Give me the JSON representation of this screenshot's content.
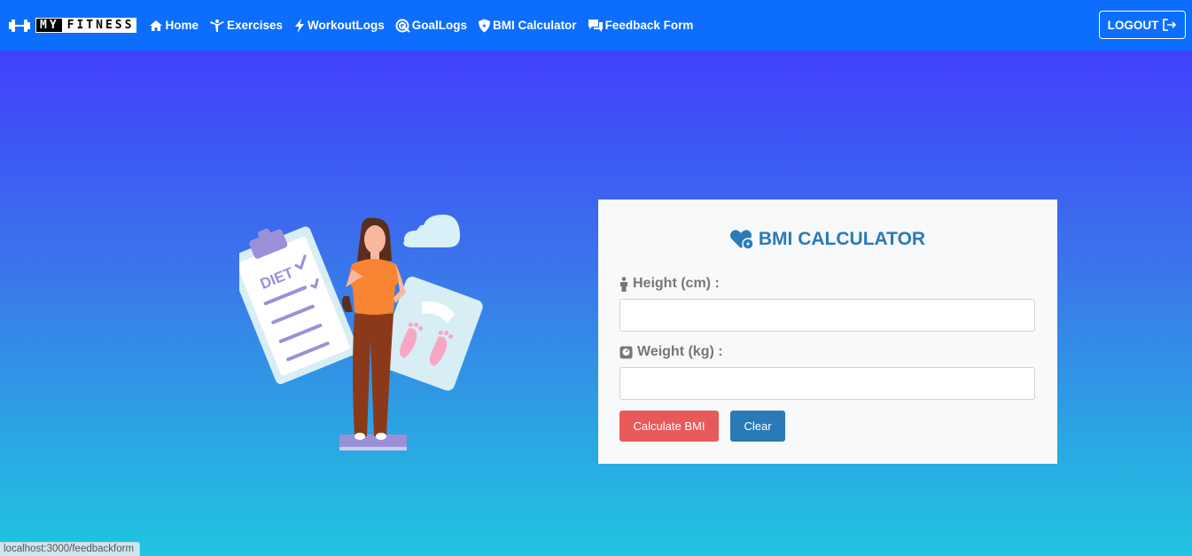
{
  "brand": {
    "my": "MY",
    "fitness": "FITNESS"
  },
  "nav": {
    "items": [
      {
        "label": "Home",
        "icon": "home-icon"
      },
      {
        "label": "Exercises",
        "icon": "exercise-icon"
      },
      {
        "label": "WorkoutLogs",
        "icon": "lightning-icon"
      },
      {
        "label": "GoalLogs",
        "icon": "target-icon"
      },
      {
        "label": "BMI Calculator",
        "icon": "shield-icon"
      },
      {
        "label": "Feedback Form",
        "icon": "chat-icon"
      }
    ],
    "logout_label": "LOGOUT",
    "logout_icon": "logout-icon"
  },
  "illustration": {
    "diet_text": "DIET"
  },
  "card": {
    "title": "BMI CALCULATOR",
    "title_icon": "heart-icon",
    "height_label": "Height (cm) :",
    "height_value": "",
    "weight_label": "Weight (kg) :",
    "weight_value": "",
    "calculate_label": "Calculate BMI",
    "clear_label": "Clear"
  },
  "status": {
    "url": "localhost:3000/feedbackform"
  },
  "colors": {
    "navbar": "#0d6efd",
    "accent": "#2a7ab8",
    "calculate": "#e85a5a"
  }
}
